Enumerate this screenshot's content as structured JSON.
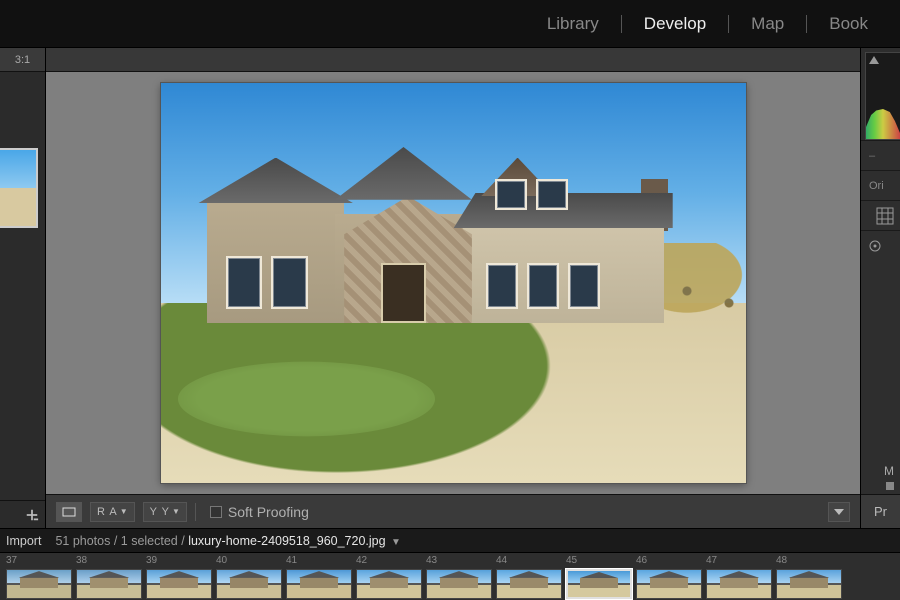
{
  "modules": {
    "library": "Library",
    "develop": "Develop",
    "map": "Map",
    "book": "Book",
    "active": "develop"
  },
  "left": {
    "zoom_ratio": "3:1"
  },
  "toolbar": {
    "soft_proofing_label": "Soft Proofing"
  },
  "right": {
    "original_label": "Ori",
    "panel_abbrev": "M",
    "previous_label": "Pr"
  },
  "status": {
    "import_label": "Import",
    "counts": "51 photos / 1 selected /",
    "filename": "luxury-home-2409518_960_720.jpg"
  },
  "filmstrip": {
    "start_index": 37,
    "count": 12,
    "selected_index": 45,
    "variants": [
      {
        "sky1": "#6aa0c8",
        "sky2": "#b0d0e8",
        "ground": "#c2b890",
        "house": "#9a8a6a"
      },
      {
        "sky1": "#6a9ec8",
        "sky2": "#aed0ec",
        "ground": "#c8be96",
        "house": "#a0906e"
      },
      {
        "sky1": "#5aa0d8",
        "sky2": "#a8d4f2",
        "ground": "#cfc39a",
        "house": "#9a886a"
      },
      {
        "sky1": "#62a4da",
        "sky2": "#b2d8f4",
        "ground": "#cbbf96",
        "house": "#968666"
      },
      {
        "sky1": "#4e98d6",
        "sky2": "#9fd0f2",
        "ground": "#cdbf94",
        "house": "#988868"
      },
      {
        "sky1": "#5aa4de",
        "sky2": "#aad4f2",
        "ground": "#d1c59a",
        "house": "#9e8e6e"
      },
      {
        "sky1": "#56a0da",
        "sky2": "#a6d2f0",
        "ground": "#cfc398",
        "house": "#9c8c6c"
      },
      {
        "sky1": "#5aa6e0",
        "sky2": "#acd6f4",
        "ground": "#d3c79c",
        "house": "#9a8a6a"
      },
      {
        "sky1": "#4a9ad8",
        "sky2": "#9cd0f4",
        "ground": "#d5c99e",
        "house": "#988868"
      },
      {
        "sky1": "#5aa6e0",
        "sky2": "#a8d2f0",
        "ground": "#d3c79c",
        "house": "#9c8c6c"
      },
      {
        "sky1": "#60a8e0",
        "sky2": "#b0d8f4",
        "ground": "#d1c59a",
        "house": "#9e8e6e"
      },
      {
        "sky1": "#5aa2dc",
        "sky2": "#a8d2f0",
        "ground": "#cfc398",
        "house": "#988868"
      }
    ]
  }
}
